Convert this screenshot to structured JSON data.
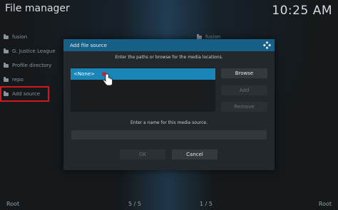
{
  "window": {
    "title": "File manager",
    "clock": "10:25 AM"
  },
  "left_pane": {
    "items": [
      {
        "label": "fusion"
      },
      {
        "label": "G. Justice League"
      },
      {
        "label": "Profile directory"
      },
      {
        "label": "repo"
      },
      {
        "label": "Add source"
      }
    ],
    "footer_left": "Root",
    "footer_count": "5 / 5"
  },
  "right_pane": {
    "items": [
      {
        "label": "fusion"
      }
    ],
    "footer_count": "1 / 5",
    "footer_right": "Root"
  },
  "dialog": {
    "title": "Add file source",
    "instruction": "Enter the paths or browse for the media locations.",
    "paths": [
      "<None>"
    ],
    "buttons": {
      "browse": "Browse",
      "add": "Add",
      "remove": "Remove",
      "ok": "OK",
      "cancel": "Cancel"
    },
    "name_instruction": "Enter a name for this media source.",
    "name_value": ""
  },
  "colors": {
    "accent": "#1a86b8",
    "header": "#165f86",
    "highlight_outline": "#d4171c"
  },
  "icons": {
    "folder": "folder-icon",
    "kodi": "kodi-logo-icon",
    "cursor": "hand-pointer-icon"
  }
}
